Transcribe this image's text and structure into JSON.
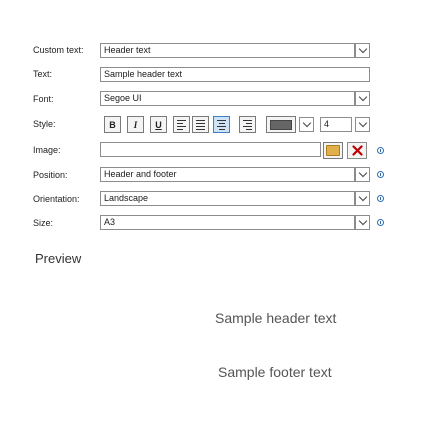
{
  "form": {
    "labels": {
      "custom_text": "Custom text:",
      "text": "Text:",
      "font": "Font:",
      "style": "Style:",
      "image": "Image:",
      "position": "Position:",
      "orientation": "Orientation:",
      "size": "Size:"
    },
    "custom_text_value": "Header text",
    "text_value": "Sample header text",
    "font_value": "Segoe UI",
    "style": {
      "bold": "B",
      "italic": "I",
      "underline": "U",
      "align_active": "center",
      "font_size": "4",
      "color": "#666666"
    },
    "image_value": "",
    "position_value": "Header and footer",
    "orientation_value": "Landscape",
    "size_value": "A3"
  },
  "preview": {
    "title": "Preview",
    "header_text": "Sample header text",
    "footer_text": "Sample footer text"
  },
  "colors": {
    "border": "#8c8c8c",
    "active": "#cfe3f7",
    "info": "#2f6db5",
    "clear": "#c00000",
    "folder": "#e2b04a"
  }
}
